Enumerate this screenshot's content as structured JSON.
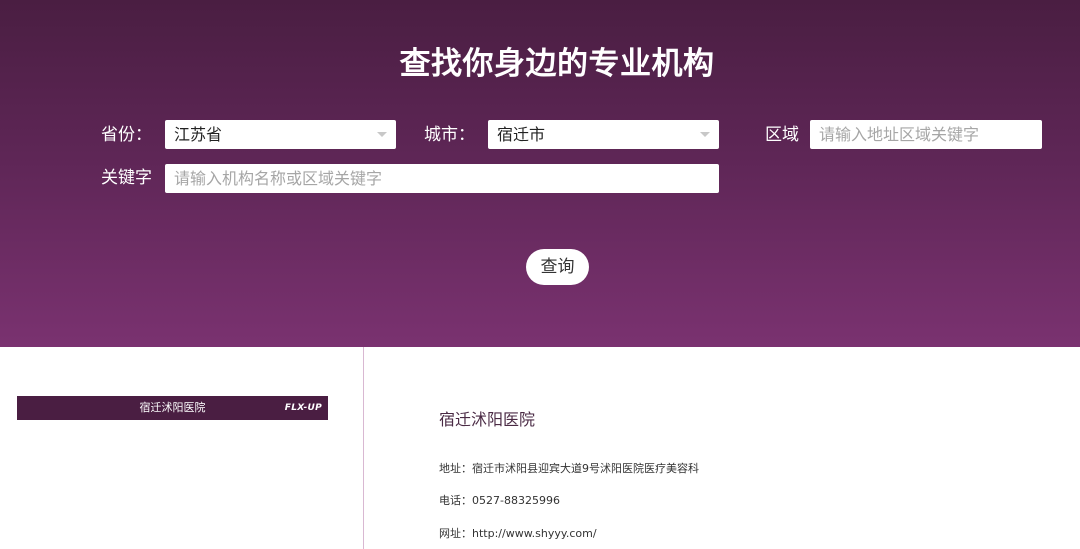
{
  "search": {
    "title": "查找你身边的专业机构",
    "province_label": "省份：",
    "province_value": "江苏省",
    "city_label": "城市：",
    "city_value": "宿迁市",
    "area_label": "区域",
    "area_placeholder": "请输入地址区域关键字",
    "keyword_label": "关键字",
    "keyword_placeholder": "请输入机构名称或区域关键字",
    "query_button": "查询"
  },
  "result": {
    "logo_name": "宿迁沭阳医院",
    "logo_brand": "FLX-UP",
    "name": "宿迁沭阳医院",
    "address": "地址：宿迁市沭阳县迎宾大道9号沭阳医院医疗美容科",
    "phone": "电话：0527-88325996",
    "website": "网址：http://www.shyyy.com/"
  },
  "colors": {
    "hero_top": "#4a1e42",
    "hero_bottom": "#7a3270",
    "accent": "#4a1e42"
  }
}
